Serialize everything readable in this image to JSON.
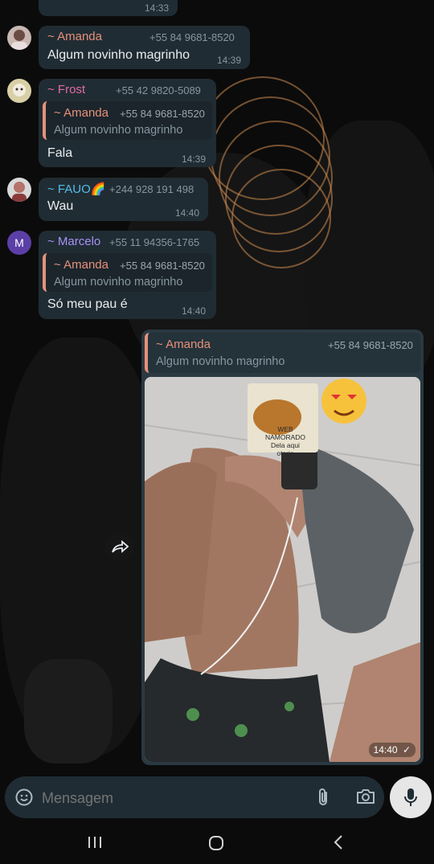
{
  "colors": {
    "bubble_in": "#202c33",
    "bubble_out": "#2a3942",
    "amanda": "#e7917a",
    "frost": "#e26aa6",
    "fauo": "#53bdeb",
    "marcelo": "#a791f7",
    "meta": "#8696a0"
  },
  "messages": [
    {
      "time": "14:33"
    },
    {
      "sender": "~ Amanda",
      "phone": "+55 84 9681-8520",
      "text": "Algum novinho magrinho",
      "time": "14:39"
    },
    {
      "sender": "~ Frost",
      "phone": "+55 42 9820-5089",
      "quote": {
        "sender": "~ Amanda",
        "phone": "+55 84 9681-8520",
        "text": "Algum novinho magrinho"
      },
      "text": "Fala",
      "time": "14:39"
    },
    {
      "sender": "~ FAUO🌈",
      "phone": "+244 928 191 498",
      "text": "Wau",
      "time": "14:40"
    },
    {
      "sender": "~ Marcelo",
      "avatar_letter": "M",
      "phone": "+55 11 94356-1765",
      "quote": {
        "sender": "~ Amanda",
        "phone": "+55 84 9681-8520",
        "text": "Algum novinho magrinho"
      },
      "text": "Só meu pau é",
      "time": "14:40"
    },
    {
      "outgoing": true,
      "quote": {
        "sender": "~ Amanda",
        "phone": "+55 84 9681-8520",
        "text": "Algum novinho magrinho"
      },
      "image": "mirror-selfie-photo",
      "time": "14:40",
      "status": "✓"
    }
  ],
  "sticker_text": [
    "WEB",
    "NAMORADO",
    "Dela aqui",
    "otario"
  ],
  "input": {
    "placeholder": "Mensagem"
  },
  "icons": {
    "emoji": "sticker-emoji-icon",
    "attach": "paperclip-icon",
    "camera": "camera-icon",
    "mic": "microphone-icon",
    "forward": "forward-icon",
    "nav_recents": "recents-icon",
    "nav_home": "home-icon",
    "nav_back": "back-icon"
  }
}
